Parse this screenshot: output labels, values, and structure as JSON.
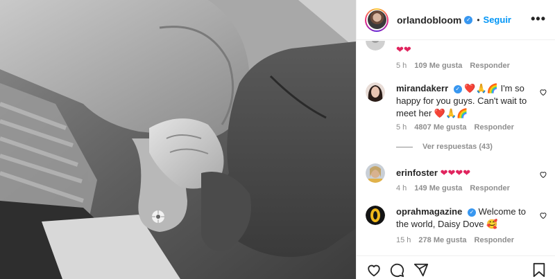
{
  "post": {
    "username": "orlandobloom",
    "verified_mark": "✓",
    "separator": "•",
    "follow_label": "Seguir",
    "more_label": "•••"
  },
  "comments": [
    {
      "username": "",
      "text": "❤❤",
      "time": "5 h",
      "likes": "109 Me gusta",
      "reply_label": "Responder",
      "avatar": "gray-avatar"
    },
    {
      "username": "mirandakerr",
      "verified": true,
      "text": "❤️🙏🌈 I'm so happy for you guys. Can't wait to meet her ❤️🙏🌈",
      "time": "5 h",
      "likes": "4807 Me gusta",
      "reply_label": "Responder",
      "view_replies": "Ver respuestas (43)",
      "avatar": "mirandakerr-avatar"
    },
    {
      "username": "erinfoster",
      "verified": false,
      "text": "❤❤❤❤",
      "time": "4 h",
      "likes": "149 Me gusta",
      "reply_label": "Responder",
      "avatar": "erinfoster-avatar"
    },
    {
      "username": "oprahmagazine",
      "verified": true,
      "text": "Welcome to the world, Daisy Dove 🥰",
      "time": "15 h",
      "likes": "278 Me gusta",
      "reply_label": "Responder",
      "avatar": "oprahmagazine-avatar"
    }
  ],
  "actions": [
    "heart-icon",
    "comment-icon",
    "share-icon",
    "bookmark-icon"
  ],
  "colors": {
    "accent": "#0095f6",
    "verified": "#3897f0",
    "muted": "#8e8e8e",
    "heart": "#e0245e"
  }
}
